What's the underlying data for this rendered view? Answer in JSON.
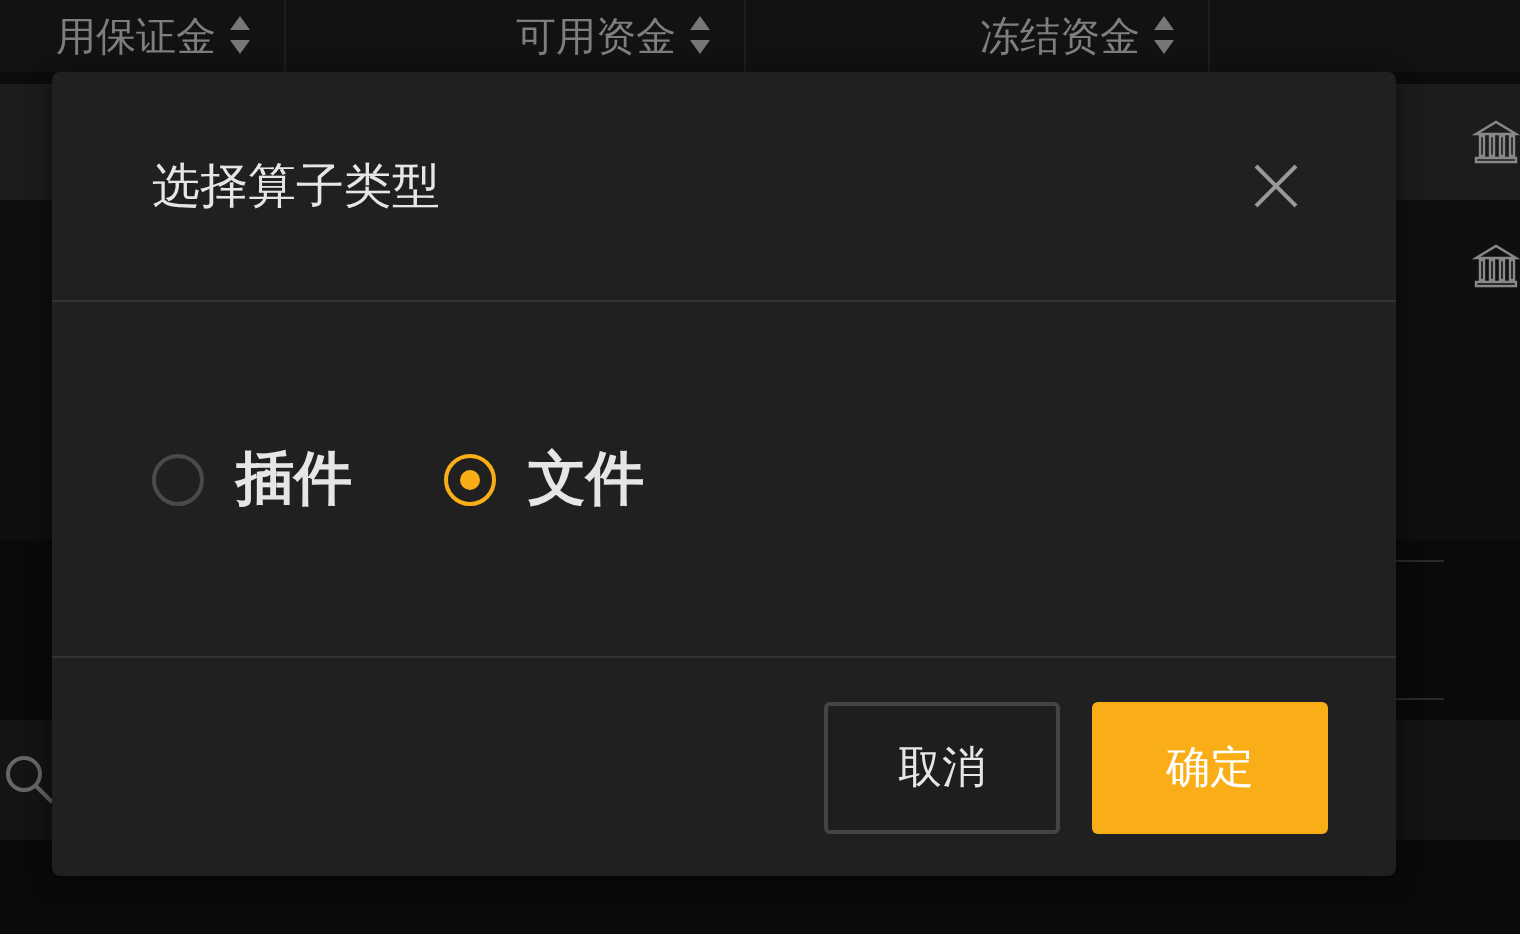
{
  "table": {
    "columns": [
      {
        "label": "用保证金"
      },
      {
        "label": "可用资金"
      },
      {
        "label": "冻结资金"
      }
    ]
  },
  "dialog": {
    "title": "选择算子类型",
    "options": [
      {
        "label": "插件",
        "selected": false
      },
      {
        "label": "文件",
        "selected": true
      }
    ],
    "buttons": [
      {
        "label": "取消",
        "kind": "secondary"
      },
      {
        "label": "确定",
        "kind": "primary"
      }
    ]
  }
}
